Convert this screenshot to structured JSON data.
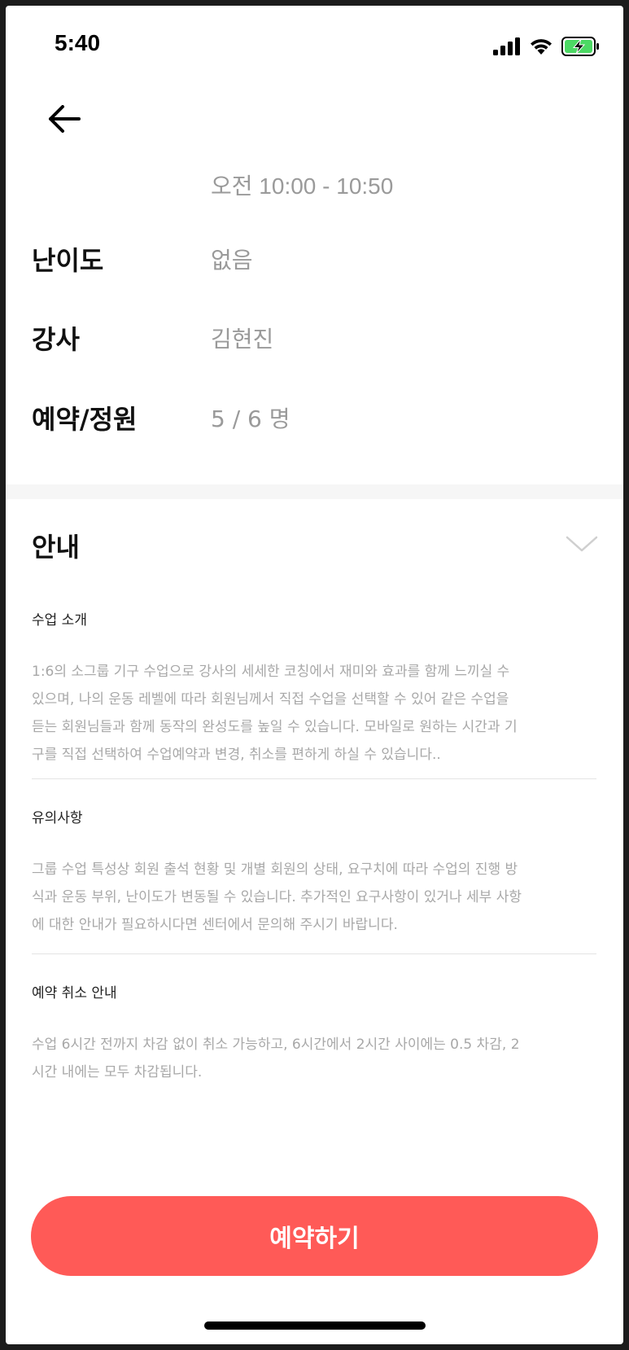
{
  "status_bar": {
    "time": "5:40",
    "icons": [
      "cellular-signal-icon",
      "wifi-icon",
      "battery-charging-icon"
    ],
    "battery_color": "#4cd964"
  },
  "header": {
    "back_icon": "arrow-left-icon"
  },
  "class_info": {
    "time_range": "오전 10:00 - 10:50",
    "rows": [
      {
        "label": "난이도",
        "value": "없음"
      },
      {
        "label": "강사",
        "value": "김현진"
      },
      {
        "label": "예약/정원",
        "value": "5 / 6 명"
      }
    ]
  },
  "notice": {
    "title": "안내",
    "toggle_icon": "chevron-down-icon",
    "sections": [
      {
        "heading": "수업 소개",
        "lines": [
          "1:6의 소그룹 기구 수업으로 강사의 세세한 코칭에서 재미와 효과를 함께 느끼실 수",
          "있으며, 나의 운동 레벨에 따라 회원님께서 직접 수업을 선택할 수 있어 같은 수업을",
          "듣는 회원님들과 함께 동작의 완성도를 높일 수 있습니다. 모바일로 원하는 시간과 기",
          "구를 직접 선택하여 수업예약과 변경, 취소를 편하게 하실 수 있습니다.."
        ]
      },
      {
        "heading": "유의사항",
        "lines": [
          "그룹 수업 특성상 회원 출석 현황 및 개별 회원의 상태, 요구치에 따라 수업의 진행 방",
          "식과 운동 부위, 난이도가 변동될 수 있습니다. 추가적인 요구사항이 있거나 세부 사항",
          "에 대한 안내가 필요하시다면 센터에서 문의해 주시기 바랍니다."
        ]
      },
      {
        "heading": "예약 취소 안내",
        "lines": [
          "수업 6시간 전까지 차감 없이 취소 가능하고, 6시간에서 2시간 사이에는 0.5 차감, 2",
          "시간 내에는 모두 차감됩니다."
        ]
      }
    ]
  },
  "actions": {
    "reserve_label": "예약하기",
    "accent_color": "#ff5a57"
  }
}
